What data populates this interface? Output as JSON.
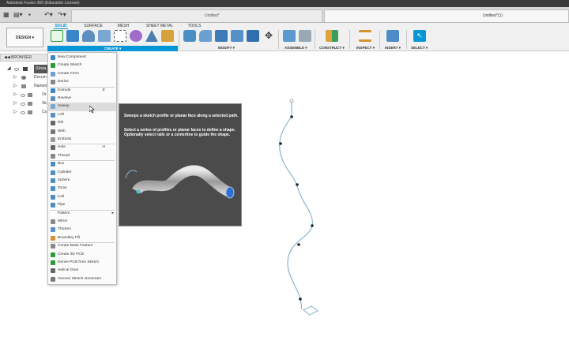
{
  "window": {
    "title": "Autodesk Fusion 360 (Education License)"
  },
  "tabs": {
    "doc1": "Untitled*",
    "doc2": "Untitled*(1)"
  },
  "toolbar": {
    "workspace": "DESIGN ▾",
    "tabs": [
      "SOLID",
      "SURFACE",
      "MESH",
      "SHEET METAL",
      "TOOLS"
    ],
    "groups": {
      "create": "CREATE ▾",
      "modify": "MODIFY ▾",
      "assemble": "ASSEMBLE ▾",
      "construct": "CONSTRUCT ▾",
      "inspect": "INSPECT ▾",
      "insert": "INSERT ▾",
      "select": "SELECT ▾"
    }
  },
  "browser": {
    "title": "BROWSER",
    "items": [
      "(Unsa",
      "Docum",
      "Named",
      "Or",
      "Sk",
      "Co"
    ]
  },
  "create_menu": {
    "items": [
      {
        "label": "New Component",
        "key": ""
      },
      {
        "label": "Create Sketch",
        "key": ""
      },
      {
        "label": "Create Form",
        "key": ""
      },
      {
        "label": "Derive",
        "key": ""
      },
      {
        "label": "Extrude",
        "key": "E"
      },
      {
        "label": "Revolve",
        "key": ""
      },
      {
        "label": "Sweep",
        "key": ""
      },
      {
        "label": "Loft",
        "key": ""
      },
      {
        "label": "Rib",
        "key": ""
      },
      {
        "label": "Web",
        "key": ""
      },
      {
        "label": "Emboss",
        "key": ""
      },
      {
        "label": "Hole",
        "key": "H"
      },
      {
        "label": "Thread",
        "key": ""
      },
      {
        "label": "Box",
        "key": ""
      },
      {
        "label": "Cylinder",
        "key": ""
      },
      {
        "label": "Sphere",
        "key": ""
      },
      {
        "label": "Torus",
        "key": ""
      },
      {
        "label": "Coil",
        "key": ""
      },
      {
        "label": "Pipe",
        "key": ""
      },
      {
        "label": "Pattern",
        "key": "▸"
      },
      {
        "label": "Mirror",
        "key": ""
      },
      {
        "label": "Thicken",
        "key": ""
      },
      {
        "label": "Boundary Fill",
        "key": ""
      },
      {
        "label": "Create Base Feature",
        "key": ""
      },
      {
        "label": "Create 3D PCB",
        "key": ""
      },
      {
        "label": "Derive PCB from Sketch",
        "key": ""
      },
      {
        "label": "Helical Gear",
        "key": ""
      },
      {
        "label": "Voronoi Sketch Generator",
        "key": ""
      }
    ],
    "highlighted": "Sweep"
  },
  "tooltip": {
    "line1": "Sweeps a sketch profile or planar face along a selected path.",
    "line2": "Select a series of profiles or planar faces to define a shape. Optionally select rails or a centerline to guide the shape."
  },
  "colors": {
    "accent": "#0696d7",
    "curve": "#6fa8c8"
  }
}
